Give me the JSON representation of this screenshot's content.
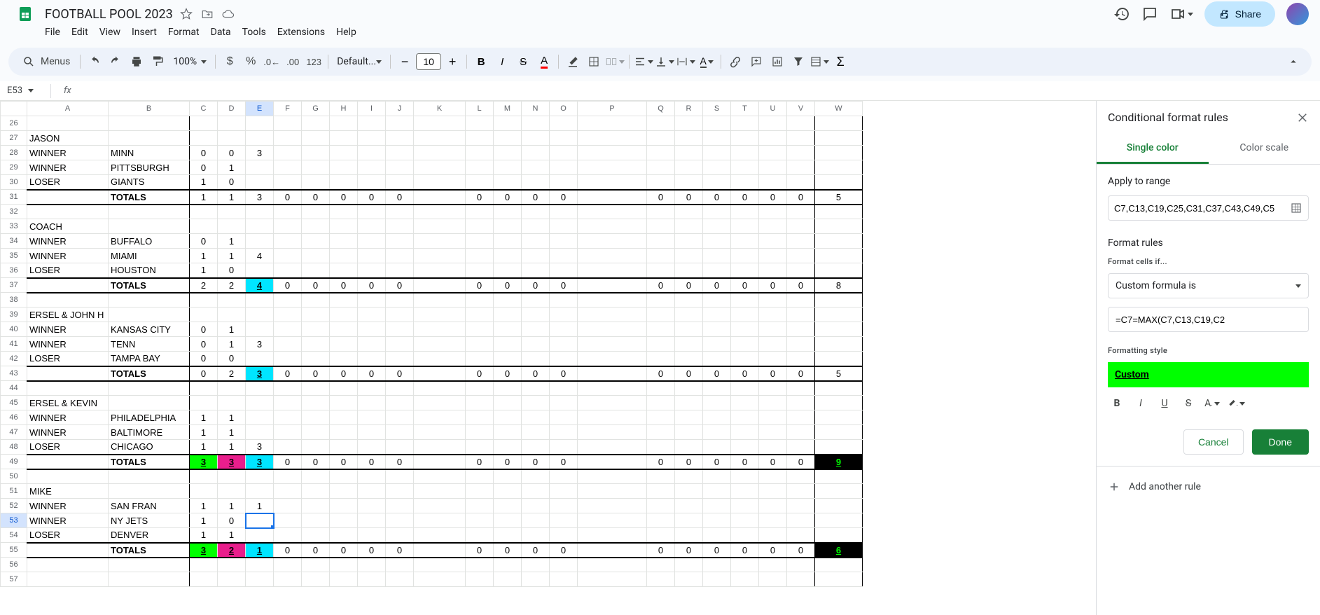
{
  "doc": {
    "title": "FOOTBALL POOL 2023"
  },
  "menu": {
    "search_label": "Menus",
    "items": [
      "File",
      "Edit",
      "View",
      "Insert",
      "Format",
      "Data",
      "Tools",
      "Extensions",
      "Help"
    ]
  },
  "toolbar": {
    "zoom": "100%",
    "font": "Default...",
    "font_size": "10",
    "share": "Share"
  },
  "cell_ref": {
    "name": "E53",
    "formula": ""
  },
  "columns": [
    "A",
    "B",
    "C",
    "D",
    "E",
    "F",
    "G",
    "H",
    "I",
    "J",
    "K",
    "L",
    "M",
    "N",
    "O",
    "P",
    "Q",
    "R",
    "S",
    "T",
    "U",
    "V",
    "W"
  ],
  "row_start": 26,
  "row_end": 57,
  "data": {
    "r27": {
      "A": "JASON"
    },
    "r28": {
      "A": "WINNER",
      "B": "MINN",
      "C": "0",
      "D": "0",
      "E": "3"
    },
    "r29": {
      "A": "WINNER",
      "B": "PITTSBURGH",
      "C": "0",
      "D": "1"
    },
    "r30": {
      "A": "LOSER",
      "B": "GIANTS",
      "C": "1",
      "D": "0"
    },
    "r31": {
      "B": "TOTALS",
      "C": "1",
      "D": "1",
      "E": "3",
      "F": "0",
      "G": "0",
      "H": "0",
      "I": "0",
      "J": "0",
      "L": "0",
      "M": "0",
      "N": "0",
      "O": "0",
      "Q": "0",
      "R": "0",
      "S": "0",
      "T": "0",
      "U": "0",
      "V": "0",
      "W": "5"
    },
    "r33": {
      "A": "COACH"
    },
    "r34": {
      "A": "WINNER",
      "B": "BUFFALO",
      "C": "0",
      "D": "1"
    },
    "r35": {
      "A": "WINNER",
      "B": "MIAMI",
      "C": "1",
      "D": "1",
      "E": "4"
    },
    "r36": {
      "A": "LOSER",
      "B": "HOUSTON",
      "C": "1",
      "D": "0"
    },
    "r37": {
      "B": "TOTALS",
      "C": "2",
      "D": "2",
      "E": "4",
      "F": "0",
      "G": "0",
      "H": "0",
      "I": "0",
      "J": "0",
      "L": "0",
      "M": "0",
      "N": "0",
      "O": "0",
      "Q": "0",
      "R": "0",
      "S": "0",
      "T": "0",
      "U": "0",
      "V": "0",
      "W": "8"
    },
    "r39": {
      "A": "ERSEL & JOHN H"
    },
    "r40": {
      "A": "WINNER",
      "B": "KANSAS CITY",
      "C": "0",
      "D": "1"
    },
    "r41": {
      "A": "WINNER",
      "B": "TENN",
      "C": "0",
      "D": "1",
      "E": "3"
    },
    "r42": {
      "A": "LOSER",
      "B": "TAMPA BAY",
      "C": "0",
      "D": "0"
    },
    "r43": {
      "B": "TOTALS",
      "C": "0",
      "D": "2",
      "E": "3",
      "F": "0",
      "G": "0",
      "H": "0",
      "I": "0",
      "J": "0",
      "L": "0",
      "M": "0",
      "N": "0",
      "O": "0",
      "Q": "0",
      "R": "0",
      "S": "0",
      "T": "0",
      "U": "0",
      "V": "0",
      "W": "5"
    },
    "r45": {
      "A": "ERSEL & KEVIN"
    },
    "r46": {
      "A": "WINNER",
      "B": "PHILADELPHIA",
      "C": "1",
      "D": "1"
    },
    "r47": {
      "A": "WINNER",
      "B": "BALTIMORE",
      "C": "1",
      "D": "1"
    },
    "r48": {
      "A": "LOSER",
      "B": "CHICAGO",
      "C": "1",
      "D": "1",
      "E": "3"
    },
    "r49": {
      "B": "TOTALS",
      "C": "3",
      "D": "3",
      "E": "3",
      "F": "0",
      "G": "0",
      "H": "0",
      "I": "0",
      "J": "0",
      "L": "0",
      "M": "0",
      "N": "0",
      "O": "0",
      "Q": "0",
      "R": "0",
      "S": "0",
      "T": "0",
      "U": "0",
      "V": "0",
      "W": "9"
    },
    "r51": {
      "A": "MIKE"
    },
    "r52": {
      "A": "WINNER",
      "B": "SAN FRAN",
      "C": "1",
      "D": "1",
      "E": "1"
    },
    "r53": {
      "A": "WINNER",
      "B": "NY JETS",
      "C": "1",
      "D": "0"
    },
    "r54": {
      "A": "LOSER",
      "B": "DENVER",
      "C": "1",
      "D": "1"
    },
    "r55": {
      "B": "TOTALS",
      "C": "3",
      "D": "2",
      "E": "1",
      "F": "0",
      "G": "0",
      "H": "0",
      "I": "0",
      "J": "0",
      "L": "0",
      "M": "0",
      "N": "0",
      "O": "0",
      "Q": "0",
      "R": "0",
      "S": "0",
      "T": "0",
      "U": "0",
      "V": "0",
      "W": "6"
    }
  },
  "highlights": {
    "r37E": "cyan",
    "r43E": "cyan",
    "r49C": "green",
    "r49D": "magenta",
    "r49E": "cyan",
    "r49W": "black",
    "r55C": "green",
    "r55D": "magenta",
    "r55E": "cyan",
    "r55W": "black"
  },
  "totals_rows": [
    31,
    37,
    43,
    49,
    55
  ],
  "section_header_rows": [
    27,
    33,
    39,
    45,
    51
  ],
  "sidebar": {
    "title": "Conditional format rules",
    "tabs": [
      "Single color",
      "Color scale"
    ],
    "apply_range_label": "Apply to range",
    "range_value": "C7,C13,C19,C25,C31,C37,C43,C49,C5",
    "format_rules_label": "Format rules",
    "format_cells_if": "Format cells if...",
    "rule_type": "Custom formula is",
    "formula_value": "=C7=MAX(C7,C13,C19,C2",
    "formatting_style_label": "Formatting style",
    "style_preview": "Custom",
    "cancel": "Cancel",
    "done": "Done",
    "add_rule": "Add another rule"
  }
}
